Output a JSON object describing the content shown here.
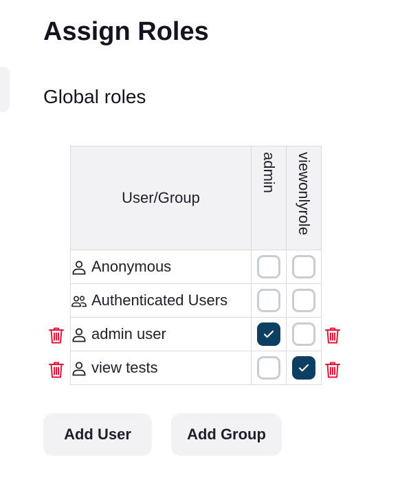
{
  "page": {
    "title": "Assign Roles"
  },
  "section": {
    "title": "Global roles"
  },
  "table": {
    "header_user": "User/Group",
    "roles": [
      "admin",
      "viewonlyrole"
    ],
    "rows": [
      {
        "name": "Anonymous",
        "type": "user",
        "deletable": false,
        "admin": false,
        "viewonlyrole": false
      },
      {
        "name": "Authenticated Users",
        "type": "group",
        "deletable": false,
        "admin": false,
        "viewonlyrole": false
      },
      {
        "name": "admin user",
        "type": "user",
        "deletable": true,
        "admin": true,
        "viewonlyrole": false
      },
      {
        "name": "view tests",
        "type": "user",
        "deletable": true,
        "admin": false,
        "viewonlyrole": true
      }
    ]
  },
  "buttons": {
    "add_user": "Add User",
    "add_group": "Add Group"
  },
  "colors": {
    "checkbox_checked": "#0d3f63",
    "checkbox_border": "#c7cdd3",
    "delete": "#e0173a",
    "header_bg": "#f2f2f5"
  },
  "icons": {
    "user": "person-icon",
    "group": "people-icon",
    "delete": "trash-icon",
    "check": "checkmark-icon"
  }
}
